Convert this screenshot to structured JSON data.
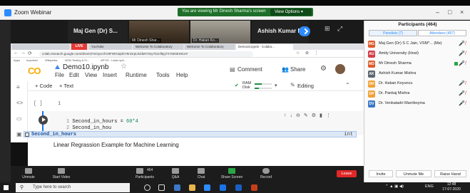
{
  "zoom": {
    "window_title": "Zoom Webinar",
    "viewing_banner": "You are viewing Mr Dinesh Sharma's screen",
    "view_options": "View Options ▾"
  },
  "videos": [
    {
      "name": "Maj Gen (Dr) S..."
    },
    {
      "name": "Mr Dinesh Shar..."
    },
    {
      "name": "Dr. Hakan Ko..."
    },
    {
      "name": "Ashish Kumar M..."
    }
  ],
  "browser": {
    "live_badge": "LIVE",
    "tabs": [
      "YouTube",
      "Welcome To Colaboratory",
      "Welcome To Colaboratory",
      "Demo10.ipynb - Colabo..."
    ],
    "url": "colab.research.google.com/drive/1FmOyvcrhV9FWH3qSbY8nGrptJs/dMYOsyYbJcf9jq7XYM03H8Ce#",
    "bookmarks": [
      "Apps",
      "Imported",
      "Wikipedia",
      "NON Testing & Fr...",
      "APTIS - Label opti..."
    ]
  },
  "colab": {
    "logo": "CO",
    "notebook_name": "Demo10.ipynb",
    "menu": [
      "File",
      "Edit",
      "View",
      "Insert",
      "Runtime",
      "Tools",
      "Help"
    ],
    "comment_label": "Comment",
    "share_label": "Share",
    "code_btn": "+ Code",
    "text_btn": "+ Text",
    "ram_label": "RAM",
    "disk_label": "Disk",
    "editing_label": "Editing",
    "cell1_prompt": "[ ]",
    "cell1_line": "1",
    "code_lines": [
      {
        "n": "1",
        "text": "Second_in_hours = ",
        "num": "60*4"
      },
      {
        "n": "2",
        "text": "Second_in_hou",
        "num": ""
      }
    ],
    "autocomplete": {
      "suggestion": "Second_in_hours",
      "type": "int"
    },
    "text_cell": "Linear Regrassion Example for Machine Learning"
  },
  "zoom_toolbar": [
    "Unmute",
    "Start Video",
    "Participants",
    "Q&A",
    "Chat",
    "Share Screen",
    "Record"
  ],
  "participants_count_badge": "464",
  "leave_label": "Leave",
  "panel": {
    "title": "Participants (464)",
    "tab_panelists": "Panelists (7)",
    "tab_attendees": "Attendees (457)",
    "people": [
      {
        "initials": "MG",
        "name": "Maj Gen (Dr) S C Jain, VSM*... (Me)",
        "color": "#e05a2b"
      },
      {
        "initials": "AU",
        "name": "Amity University (Host)",
        "color": "#d33f49"
      },
      {
        "initials": "MD",
        "name": "Mr Dinesh Sharma",
        "color": "#e05a2b"
      },
      {
        "initials": "AK",
        "name": "Ashish Kumar Mishra",
        "color": "#5b6670"
      },
      {
        "initials": "DH",
        "name": "Dr. Hakan Koyuncu",
        "color": "#f2a036"
      },
      {
        "initials": "DP",
        "name": "Dr. Pankaj Mishra",
        "color": "#f2a036"
      },
      {
        "initials": "DV",
        "name": "Dr. Venkatadri Marriboyina",
        "color": "#3d78c8"
      }
    ],
    "invite_label": "Invite",
    "unmute_me_label": "Unmute Me",
    "raise_hand_label": "Raise Hand"
  },
  "taskbar": {
    "search_placeholder": "Type here to search",
    "lang": "ENG",
    "time": "12:48",
    "date": "17-07-2020"
  }
}
